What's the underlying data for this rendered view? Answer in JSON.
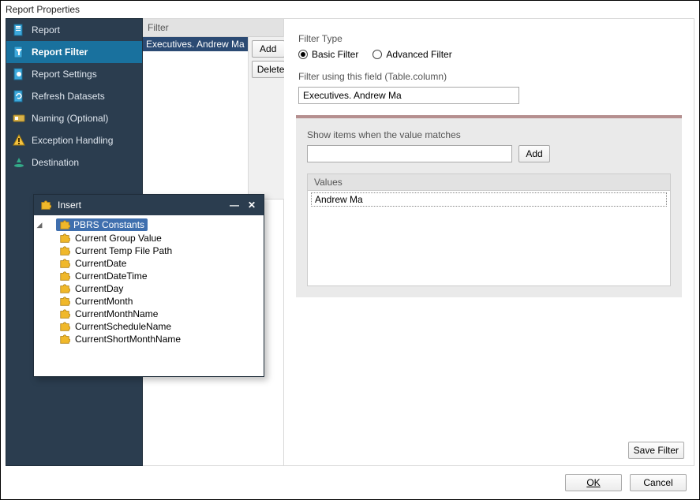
{
  "window": {
    "title": "Report Properties"
  },
  "sidebar": {
    "items": [
      {
        "label": "Report",
        "icon": "report-icon"
      },
      {
        "label": "Report Filter",
        "icon": "filter-icon",
        "selected": true
      },
      {
        "label": "Report Settings",
        "icon": "settings-icon"
      },
      {
        "label": "Refresh Datasets",
        "icon": "refresh-icon"
      },
      {
        "label": "Naming (Optional)",
        "icon": "naming-icon"
      },
      {
        "label": "Exception Handling",
        "icon": "warning-icon"
      },
      {
        "label": "Destination",
        "icon": "destination-icon"
      }
    ]
  },
  "filterList": {
    "header": "Filter",
    "items": [
      "Executives. Andrew Ma"
    ],
    "add": "Add",
    "delete": "Delete"
  },
  "main": {
    "filterTypeLabel": "Filter Type",
    "basic": "Basic Filter",
    "advanced": "Advanced Filter",
    "fieldLabel": "Filter using this field (Table.column)",
    "fieldValue": "Executives. Andrew Ma",
    "matchLabel": "Show items when the value matches",
    "matchValue": "",
    "addBtn": "Add",
    "valuesHeader": "Values",
    "valueItems": [
      "Andrew Ma"
    ],
    "saveFilter": "Save Filter"
  },
  "buttons": {
    "ok": "OK",
    "cancel": "Cancel"
  },
  "insert": {
    "title": "Insert",
    "root": "PBRS Constants",
    "items": [
      "Current Group Value",
      "Current Temp File Path",
      "CurrentDate",
      "CurrentDateTime",
      "CurrentDay",
      "CurrentMonth",
      "CurrentMonthName",
      "CurrentScheduleName",
      "CurrentShortMonthName"
    ]
  }
}
